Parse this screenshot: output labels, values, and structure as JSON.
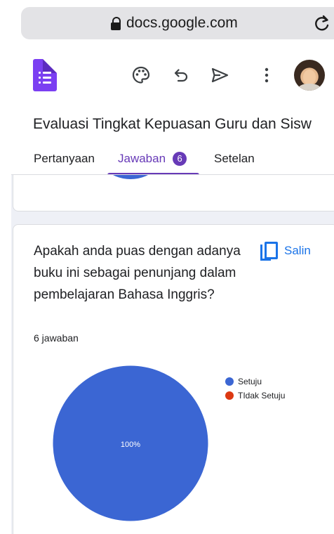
{
  "browser": {
    "url": "docs.google.com"
  },
  "app": {
    "icons": [
      "palette-icon",
      "undo-icon",
      "send-icon",
      "more-vert-icon"
    ]
  },
  "form": {
    "title": "Evaluasi Tingkat Kepuasan Guru dan Sisw"
  },
  "tabs": [
    {
      "label": "Pertanyaan"
    },
    {
      "label": "Jawaban",
      "badge": "6"
    },
    {
      "label": "Setelan"
    }
  ],
  "question": {
    "text": "Apakah anda puas dengan adanya buku ini sebagai penunjang dalam pembelajaran Bahasa Inggris?",
    "copy_label": "Salin",
    "response_count": "6 jawaban"
  },
  "colors": {
    "accent": "#673ab7",
    "link": "#1a73e8",
    "series_agree": "#3b66d3",
    "series_disagree": "#dc3912"
  },
  "chart_data": {
    "type": "pie",
    "categories": [
      "Setuju",
      "TIdak Setuju"
    ],
    "values": [
      100,
      0
    ],
    "data_labels": [
      "100%"
    ],
    "legend_position": "top-right"
  }
}
